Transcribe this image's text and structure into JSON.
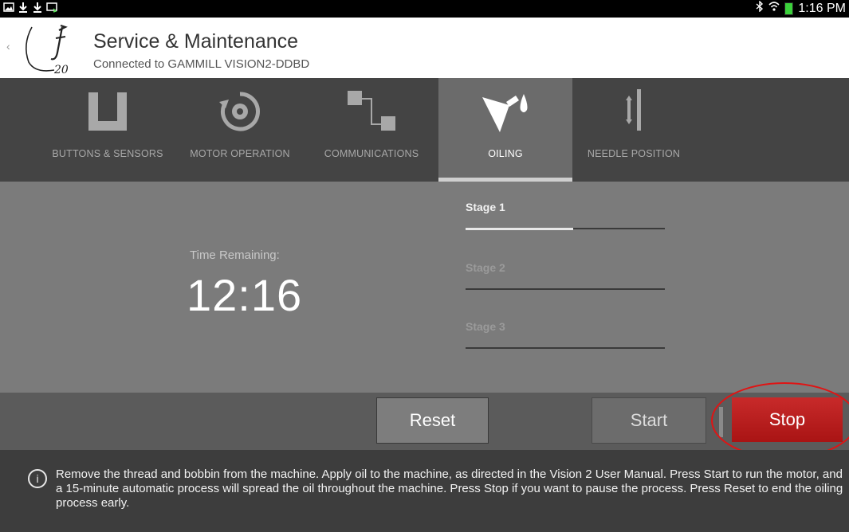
{
  "status_bar": {
    "left_icons": [
      "image-icon",
      "download-icon",
      "download-icon",
      "cast-icon"
    ],
    "bluetooth_icon": "bluetooth-icon",
    "wifi_icon": "wifi-icon",
    "battery_icon": "battery-icon",
    "time": "1:16 PM"
  },
  "app_bar": {
    "title": "Service & Maintenance",
    "subtitle": "Connected to GAMMILL VISION2-DDBD",
    "logo_text": "20"
  },
  "tabs": [
    {
      "label": "BUTTONS & SENSORS",
      "icon": "u-bracket-icon",
      "active": false
    },
    {
      "label": "MOTOR OPERATION",
      "icon": "gear-cycle-icon",
      "active": false
    },
    {
      "label": "COMMUNICATIONS",
      "icon": "connection-blocks-icon",
      "active": false
    },
    {
      "label": "OILING",
      "icon": "oil-can-icon",
      "active": true
    },
    {
      "label": "NEEDLE POSITION",
      "icon": "needle-icon",
      "active": false
    }
  ],
  "oiling": {
    "time_label": "Time Remaining:",
    "time_value": "12:16",
    "stages": [
      {
        "label": "Stage 1",
        "progress": 0.54,
        "active": true
      },
      {
        "label": "Stage 2",
        "progress": 0,
        "active": false
      },
      {
        "label": "Stage 3",
        "progress": 0,
        "active": false
      }
    ]
  },
  "buttons": {
    "reset": "Reset",
    "start": "Start",
    "stop": "Stop"
  },
  "colors": {
    "stop_button": "#b81d1d",
    "highlight": "#e01414",
    "active_tab": "#6b6b6b"
  },
  "info": {
    "icon": "info-icon",
    "text": "Remove the thread and bobbin from the machine. Apply oil to the machine, as directed in the Vision 2 User Manual. Press Start to run the motor, and a 15-minute automatic process will spread the oil throughout the machine. Press Stop if you want to pause the process. Press Reset to end the oiling process early."
  }
}
